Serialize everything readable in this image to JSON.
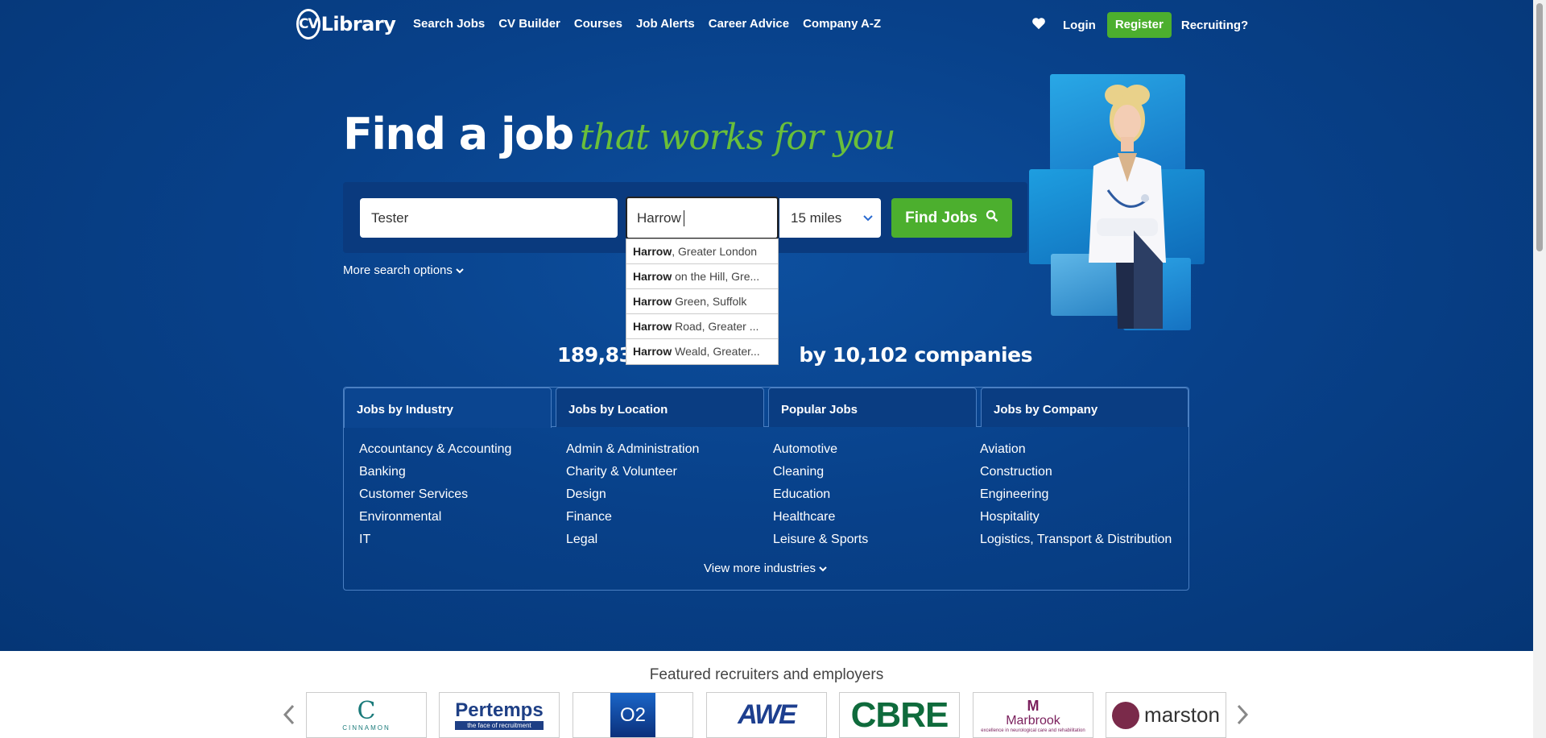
{
  "nav": {
    "logo_cv": "CV",
    "logo_library": "Library",
    "links": [
      "Search Jobs",
      "CV Builder",
      "Courses",
      "Job Alerts",
      "Career Advice",
      "Company A-Z"
    ],
    "login": "Login",
    "register": "Register",
    "recruiting": "Recruiting?",
    "colors": {
      "register": "#4caf2e"
    }
  },
  "hero": {
    "headline_bold": "Find a job",
    "headline_script": "that works for you"
  },
  "search": {
    "keywords_value": "Tester",
    "location_value": "Harrow",
    "radius_value": "15 miles",
    "find_button": "Find Jobs",
    "more_options": "More search options"
  },
  "autocomplete": [
    {
      "match": "Harrow",
      "rest": ", Greater London"
    },
    {
      "match": "Harrow",
      "rest": " on the Hill, Gre..."
    },
    {
      "match": "Harrow",
      "rest": " Green, Suffolk"
    },
    {
      "match": "Harrow",
      "rest": " Road, Greater ..."
    },
    {
      "match": "Harrow",
      "rest": " Weald, Greater..."
    }
  ],
  "stats": {
    "jobs_count": "189,835",
    "companies_text": "by 10,102 companies"
  },
  "tabs": [
    "Jobs by Industry",
    "Jobs by Location",
    "Popular Jobs",
    "Jobs by Company"
  ],
  "categories": [
    [
      "Accountancy & Accounting",
      "Banking",
      "Customer Services",
      "Environmental",
      "IT"
    ],
    [
      "Admin & Administration",
      "Charity & Volunteer",
      "Design",
      "Finance",
      "Legal"
    ],
    [
      "Automotive",
      "Cleaning",
      "Education",
      "Healthcare",
      "Leisure & Sports"
    ],
    [
      "Aviation",
      "Construction",
      "Engineering",
      "Hospitality",
      "Logistics, Transport & Distribution"
    ]
  ],
  "view_more": "View more industries",
  "featured": {
    "title": "Featured recruiters and employers",
    "logos": [
      "CINNAMON",
      "Pertemps",
      "O2",
      "AWE",
      "CBRE",
      "Marbrook",
      "marston"
    ],
    "pertemps_tagline": "the face of recruitment",
    "marbrook_tagline": "excellence in neurological care and rehabilitation"
  }
}
